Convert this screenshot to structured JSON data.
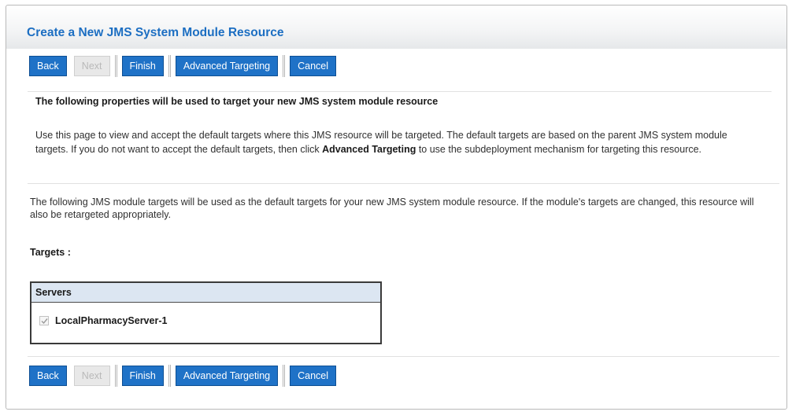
{
  "page": {
    "title": "Create a New JMS System Module Resource"
  },
  "toolbar": {
    "back_label": "Back",
    "next_label": "Next",
    "finish_label": "Finish",
    "advanced_targeting_label": "Advanced Targeting",
    "cancel_label": "Cancel"
  },
  "section": {
    "heading": "The following properties will be used to target your new JMS system module resource",
    "description_before": "Use this page to view and accept the default targets where this JMS resource will be targeted. The default targets are based on the parent JMS system module targets. If you do not want to accept the default targets, then click ",
    "description_bold": "Advanced Targeting",
    "description_after": " to use the subdeployment mechanism for targeting this resource."
  },
  "info": {
    "text": "The following JMS module targets will be used as the default targets for your new JMS system module resource. If the module's targets are changed, this resource will also be retargeted appropriately."
  },
  "targets": {
    "label": "Targets :",
    "table_header": "Servers",
    "servers": [
      {
        "name": "LocalPharmacyServer-1",
        "checked": true,
        "disabled": true
      }
    ]
  },
  "colors": {
    "title": "#1c6ec2",
    "button": "#1f72c7",
    "button_disabled": "#e8e8e8",
    "table_header": "#dce6f2"
  }
}
